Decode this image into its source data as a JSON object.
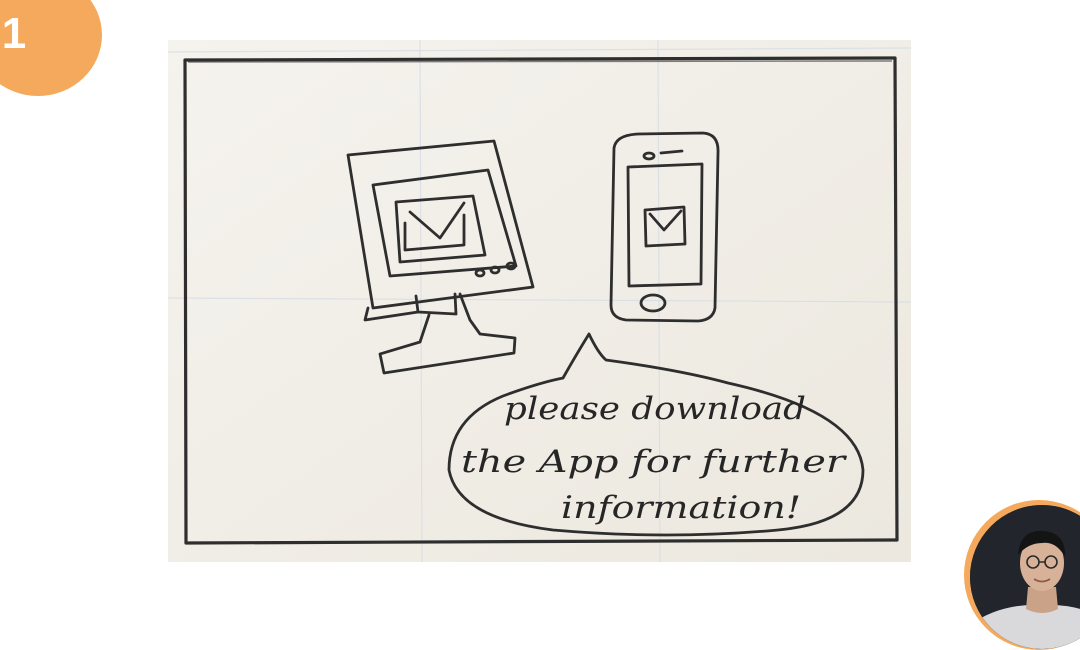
{
  "slide": {
    "number": "1",
    "badge_color": "#f5a95c"
  },
  "sketch": {
    "speech_bubble": {
      "line1": "please download",
      "line2": "the App for further",
      "line3": "information!"
    },
    "paper_color": "#f3f0e8",
    "pencil_color": "#2e2e2e"
  },
  "presenter": {
    "ring_color": "#f5a95c"
  }
}
